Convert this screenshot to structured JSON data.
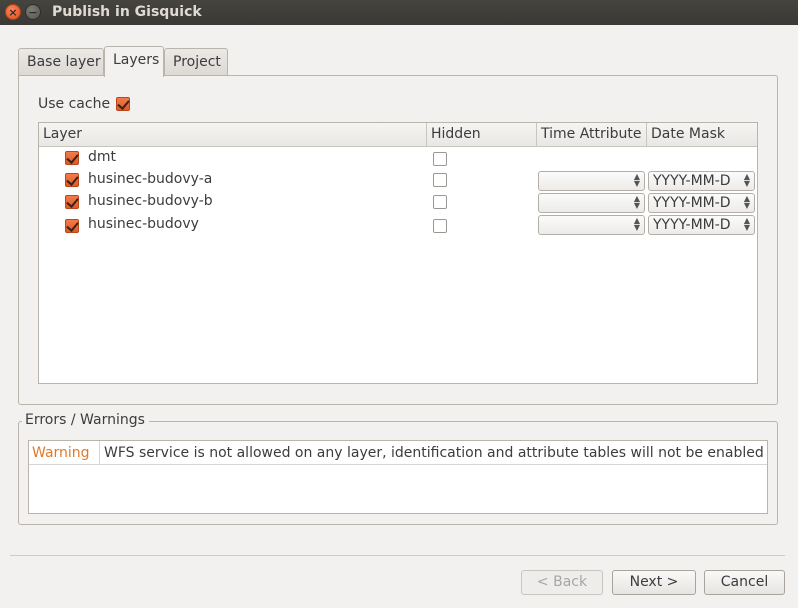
{
  "window": {
    "title": "Publish in Gisquick"
  },
  "tabs": [
    {
      "label": "Base layer",
      "active": false
    },
    {
      "label": "Layers",
      "active": true
    },
    {
      "label": "Project",
      "active": false
    }
  ],
  "layers_tab": {
    "use_cache_label": "Use cache",
    "use_cache_checked": true,
    "columns": {
      "layer": "Layer",
      "hidden": "Hidden",
      "time_attribute": "Time Attribute",
      "date_mask": "Date Mask"
    },
    "rows": [
      {
        "name": "dmt",
        "checked": true,
        "hidden": false,
        "time_attribute": null,
        "date_mask": null
      },
      {
        "name": "husinec-budovy-a",
        "checked": true,
        "hidden": false,
        "time_attribute": "",
        "date_mask": "YYYY-MM-D"
      },
      {
        "name": "husinec-budovy-b",
        "checked": true,
        "hidden": false,
        "time_attribute": "",
        "date_mask": "YYYY-MM-D"
      },
      {
        "name": "husinec-budovy",
        "checked": true,
        "hidden": false,
        "time_attribute": "",
        "date_mask": "YYYY-MM-D"
      }
    ]
  },
  "errors": {
    "title": "Errors / Warnings",
    "items": [
      {
        "level": "Warning",
        "message": "WFS service is not allowed on any layer, identification and attribute tables will not be enabled (…"
      }
    ]
  },
  "buttons": {
    "back": {
      "label": "< Back",
      "mnemonic": "B",
      "enabled": false
    },
    "next": {
      "label": "Next >",
      "mnemonic": "N",
      "enabled": true
    },
    "cancel": {
      "label": "Cancel",
      "enabled": true
    }
  },
  "colors": {
    "accent": "#e8672f",
    "warning": "#e07a2b",
    "titlebar": "#3c3b37"
  }
}
